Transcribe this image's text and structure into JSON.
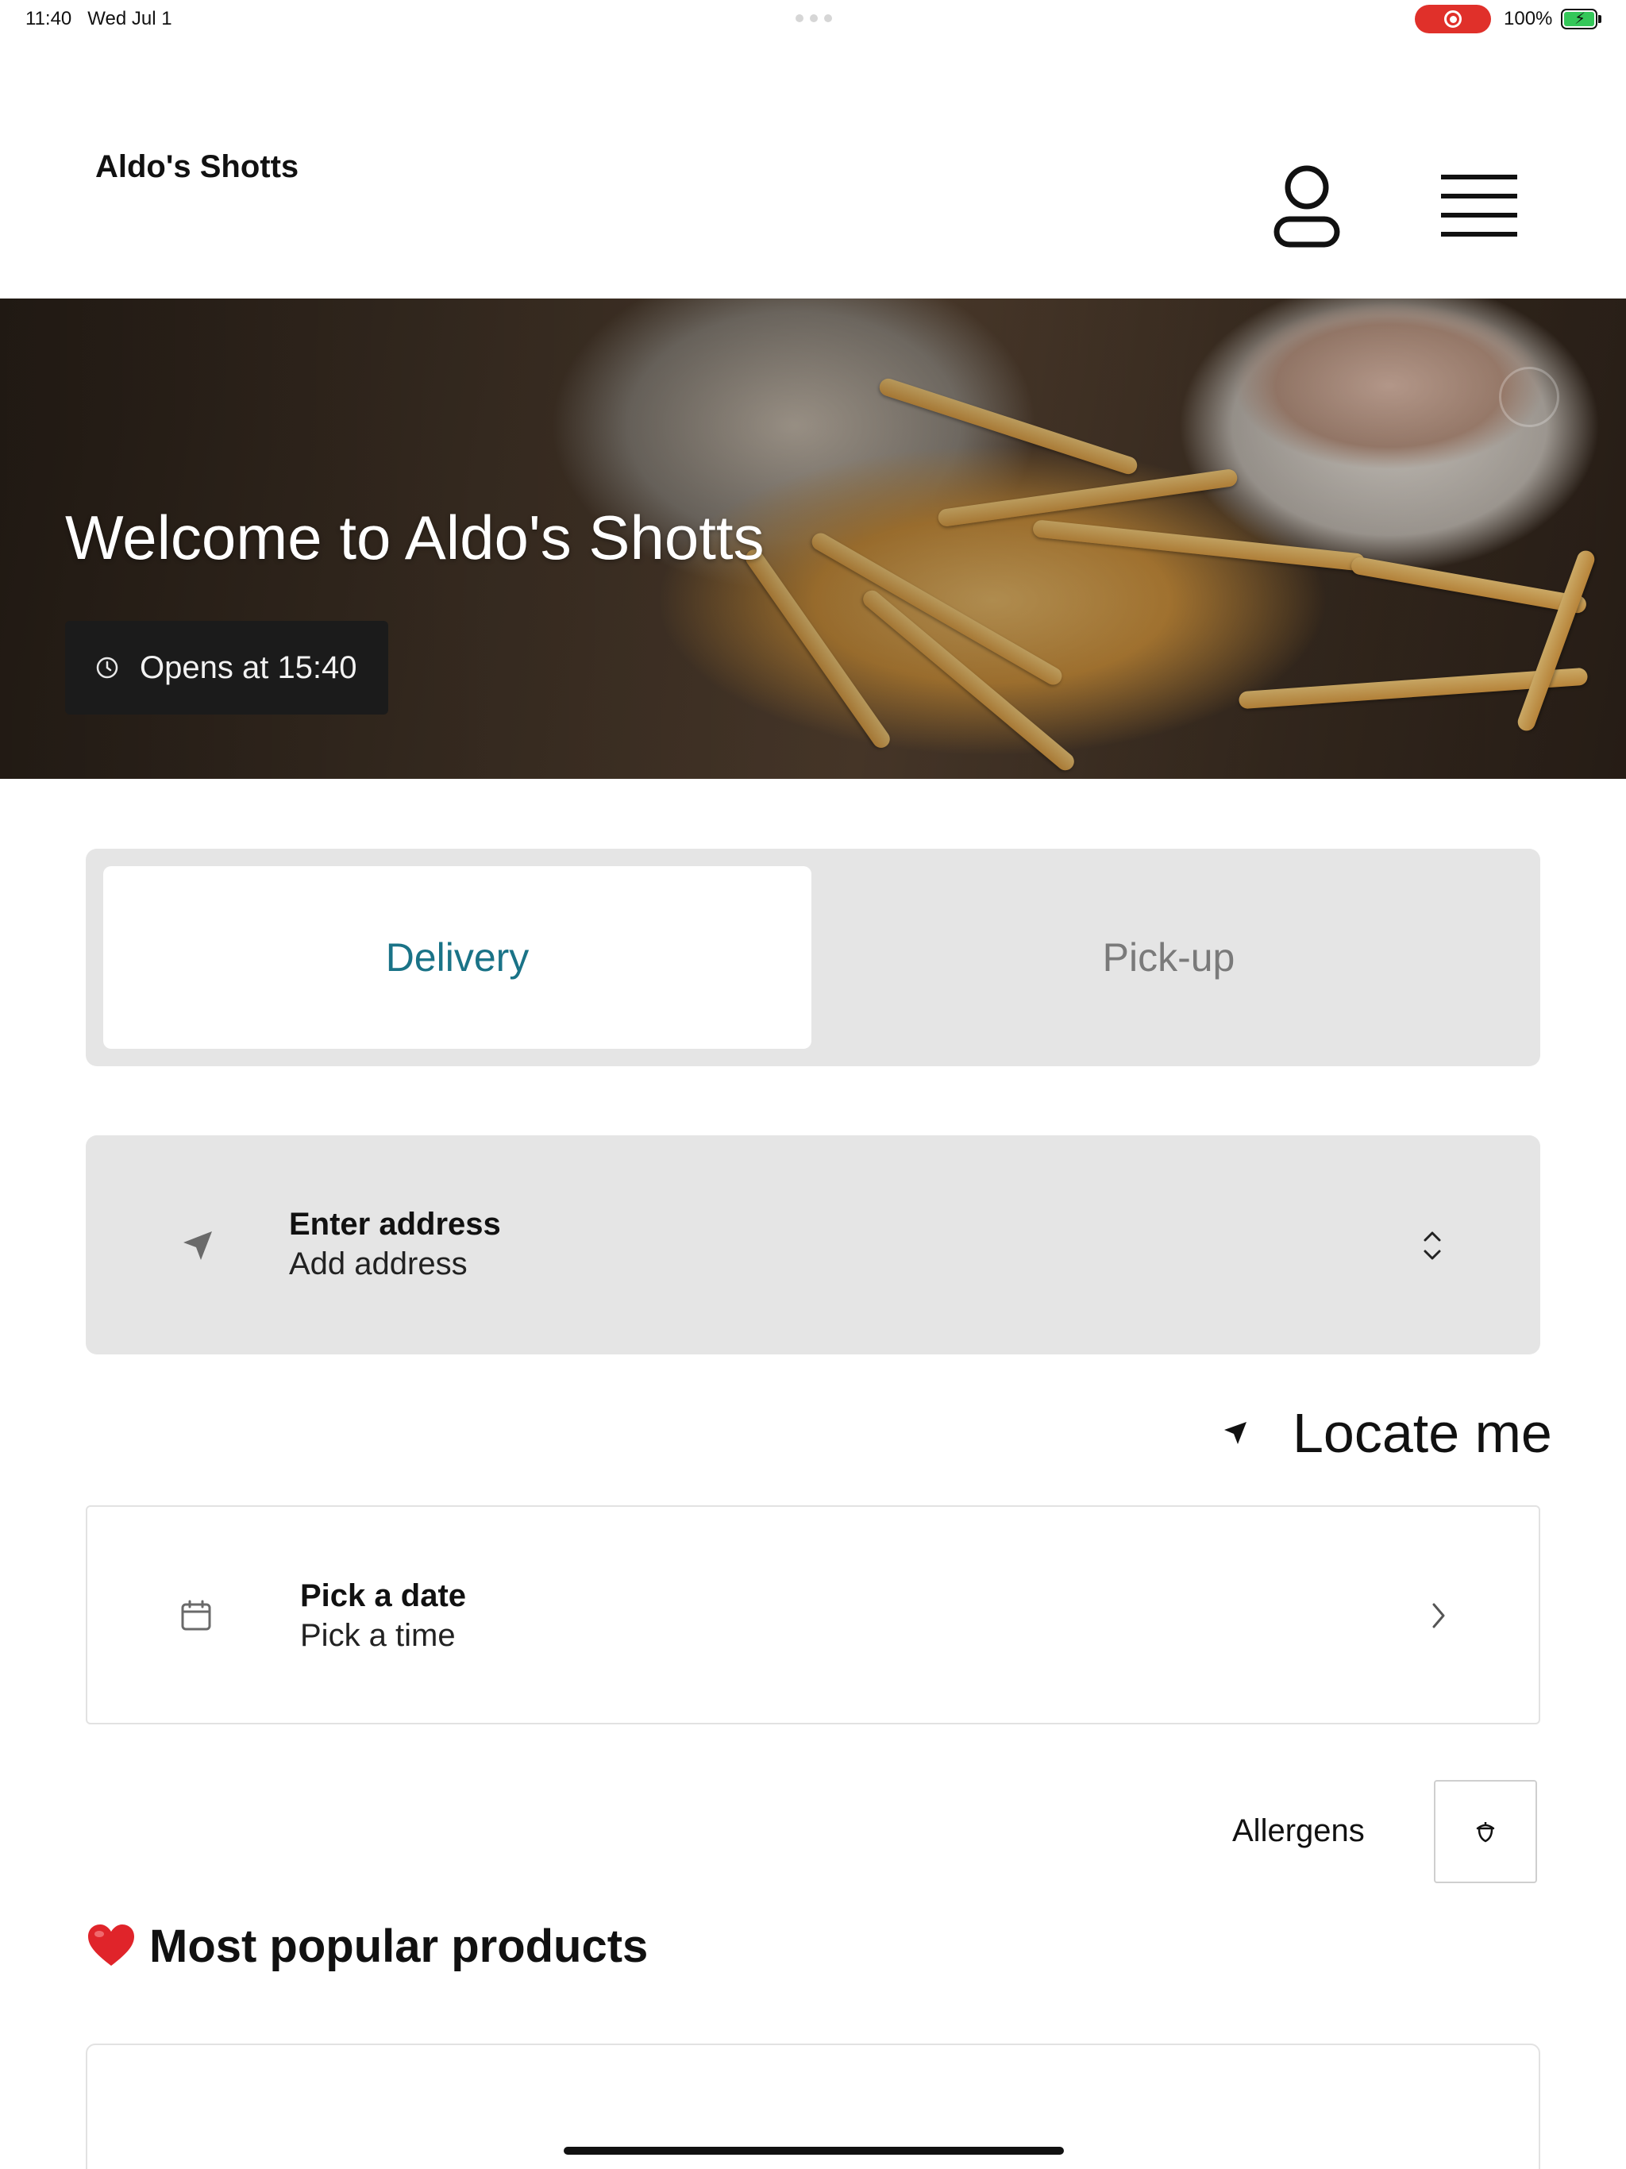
{
  "status_bar": {
    "time": "11:40",
    "date": "Wed Jul 1",
    "battery": "100%",
    "recording_color": "#e0302a",
    "battery_color": "#34c759"
  },
  "header": {
    "brand": "Aldo's Shotts",
    "account_icon": "user-icon",
    "menu_icon": "hamburger-menu-icon"
  },
  "hero": {
    "title": "Welcome to Aldo's Shotts",
    "opens_text": "Opens at 15:40",
    "clock_icon": "clock-icon"
  },
  "order_mode": {
    "options": [
      "Delivery",
      "Pick-up"
    ],
    "selected": "Delivery",
    "active_color": "#1a7387"
  },
  "address": {
    "title": "Enter address",
    "subtitle": "Add address",
    "icon": "navigation-arrow-icon",
    "expand_icon": "chevron-up-down-icon"
  },
  "locate": {
    "label": "Locate me",
    "icon": "location-arrow-icon"
  },
  "schedule": {
    "date_label": "Pick a date",
    "time_label": "Pick a time",
    "icon": "calendar-icon",
    "chevron_icon": "chevron-right-icon"
  },
  "allergens": {
    "label": "Allergens",
    "icon": "acorn-icon"
  },
  "popular": {
    "heading": "Most popular products",
    "icon": "heart-icon"
  }
}
